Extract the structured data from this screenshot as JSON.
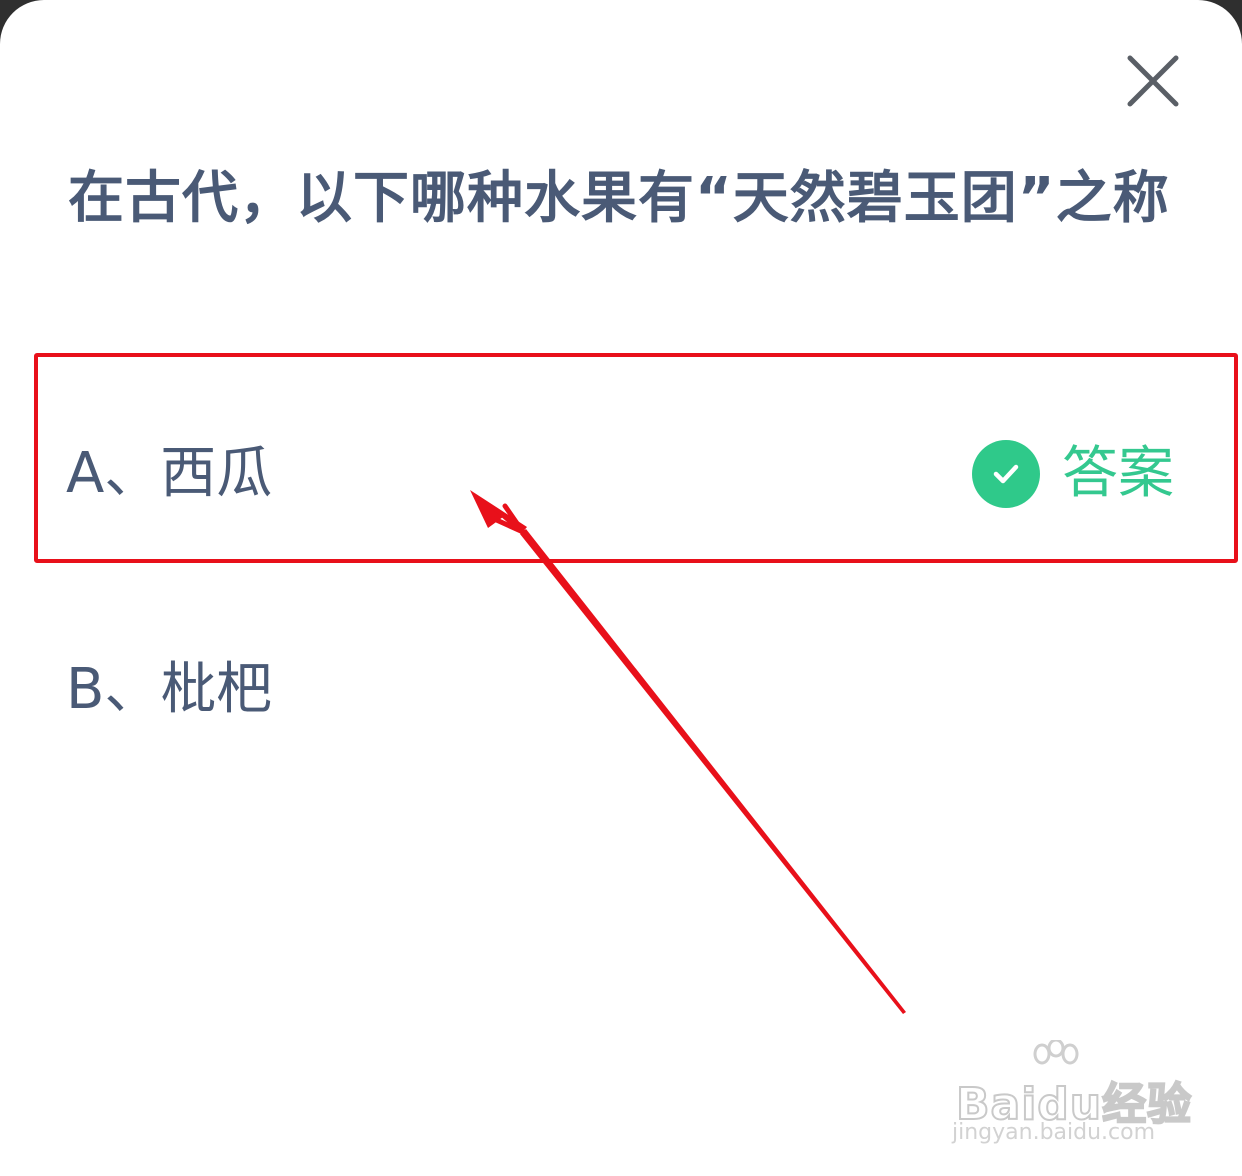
{
  "dialog": {
    "question": "在古代，以下哪种水果有“天然碧玉团”之称",
    "close_icon": "close-icon"
  },
  "options": [
    {
      "label": "A、西瓜",
      "is_answer": true
    },
    {
      "label": "B、枇杷",
      "is_answer": false
    }
  ],
  "answer_badge": {
    "text": "答案",
    "icon": "check-circle-icon",
    "color": "#2fc98a"
  },
  "annotation": {
    "highlight_color": "#e8101a",
    "arrow_color": "#e8101a"
  },
  "watermark": {
    "brand": "Baidu经验",
    "url": "jingyan.baidu.com"
  },
  "colors": {
    "text": "#4a5a76",
    "background": "#ffffff"
  }
}
